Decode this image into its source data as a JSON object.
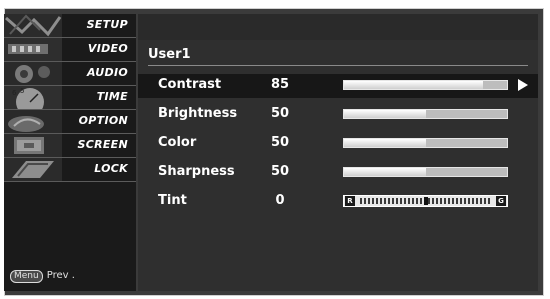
{
  "menu": {
    "items": [
      {
        "label": "SETUP"
      },
      {
        "label": "VIDEO"
      },
      {
        "label": "AUDIO"
      },
      {
        "label": "TIME"
      },
      {
        "label": "OPTION"
      },
      {
        "label": "SCREEN"
      },
      {
        "label": "LOCK"
      }
    ],
    "footer": {
      "key": "Menu",
      "label": "Prev ."
    }
  },
  "video": {
    "preset": "User1",
    "rows": [
      {
        "label": "Contrast",
        "value": "85",
        "level": 0.85
      },
      {
        "label": "Brightness",
        "value": "50",
        "level": 0.5
      },
      {
        "label": "Color",
        "value": "50",
        "level": 0.5
      },
      {
        "label": "Sharpness",
        "value": "50",
        "level": 0.5
      },
      {
        "label": "Tint",
        "value": "0",
        "left_letter": "R",
        "right_letter": "G"
      }
    ]
  },
  "colors": {
    "menu_bg": "#1a1a1a",
    "panel_bg": "#2f2f2f",
    "selected_row_bg": "#171717",
    "text": "#ffffff"
  }
}
